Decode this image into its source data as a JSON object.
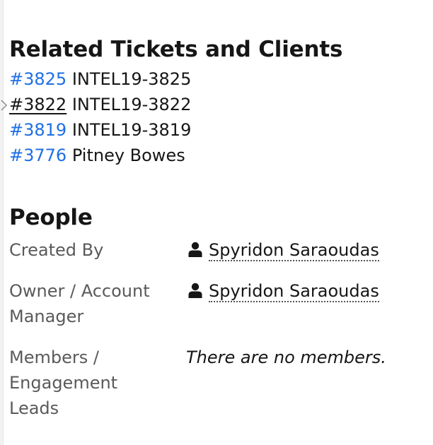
{
  "related": {
    "title": "Related Tickets and Clients",
    "tickets": [
      {
        "id": "#3825",
        "name": "INTEL19-3825",
        "visited": false
      },
      {
        "id": "#3822",
        "name": "INTEL19-3822",
        "visited": true
      },
      {
        "id": "#3819",
        "name": "INTEL19-3819",
        "visited": false
      },
      {
        "id": "#3776",
        "name": "Pitney Bowes",
        "visited": false
      }
    ]
  },
  "people": {
    "title": "People",
    "created_by": {
      "label": "Created By",
      "value": "Spyridon Saraoudas"
    },
    "owner": {
      "label": "Owner / Account Manager",
      "value": "Spyridon Saraoudas"
    },
    "members": {
      "label": "Members / Engagement Leads",
      "value": "There are no members."
    }
  },
  "icons": {
    "person": "person-icon",
    "caret": "chevron-right-icon"
  },
  "colors": {
    "link": "#1f6fe5",
    "text": "#161616",
    "label": "#5a5a5a"
  }
}
